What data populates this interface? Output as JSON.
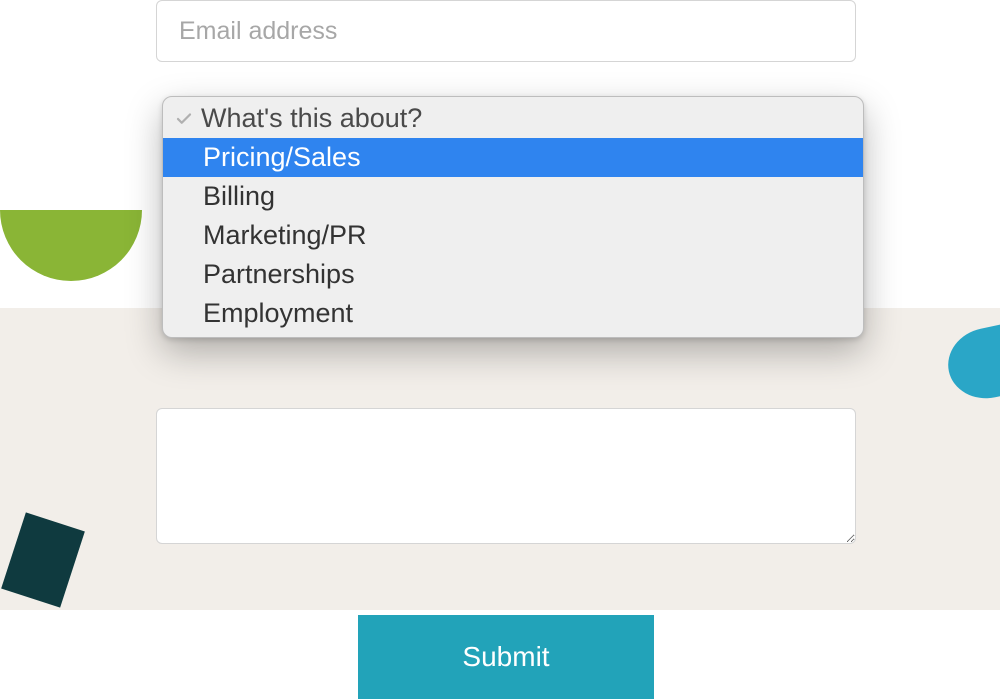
{
  "form": {
    "email_placeholder": "Email address",
    "email_value": "",
    "textarea_value": "",
    "submit_label": "Submit"
  },
  "dropdown": {
    "prompt": "What's this about?",
    "options": [
      "Pricing/Sales",
      "Billing",
      "Marketing/PR",
      "Partnerships",
      "Employment"
    ],
    "highlighted_index": 0
  },
  "colors": {
    "accent_teal": "#22a3b9",
    "highlight_blue": "#2f84ef",
    "green_shape": "#8ab536",
    "bg_beige": "#f2eee9"
  }
}
